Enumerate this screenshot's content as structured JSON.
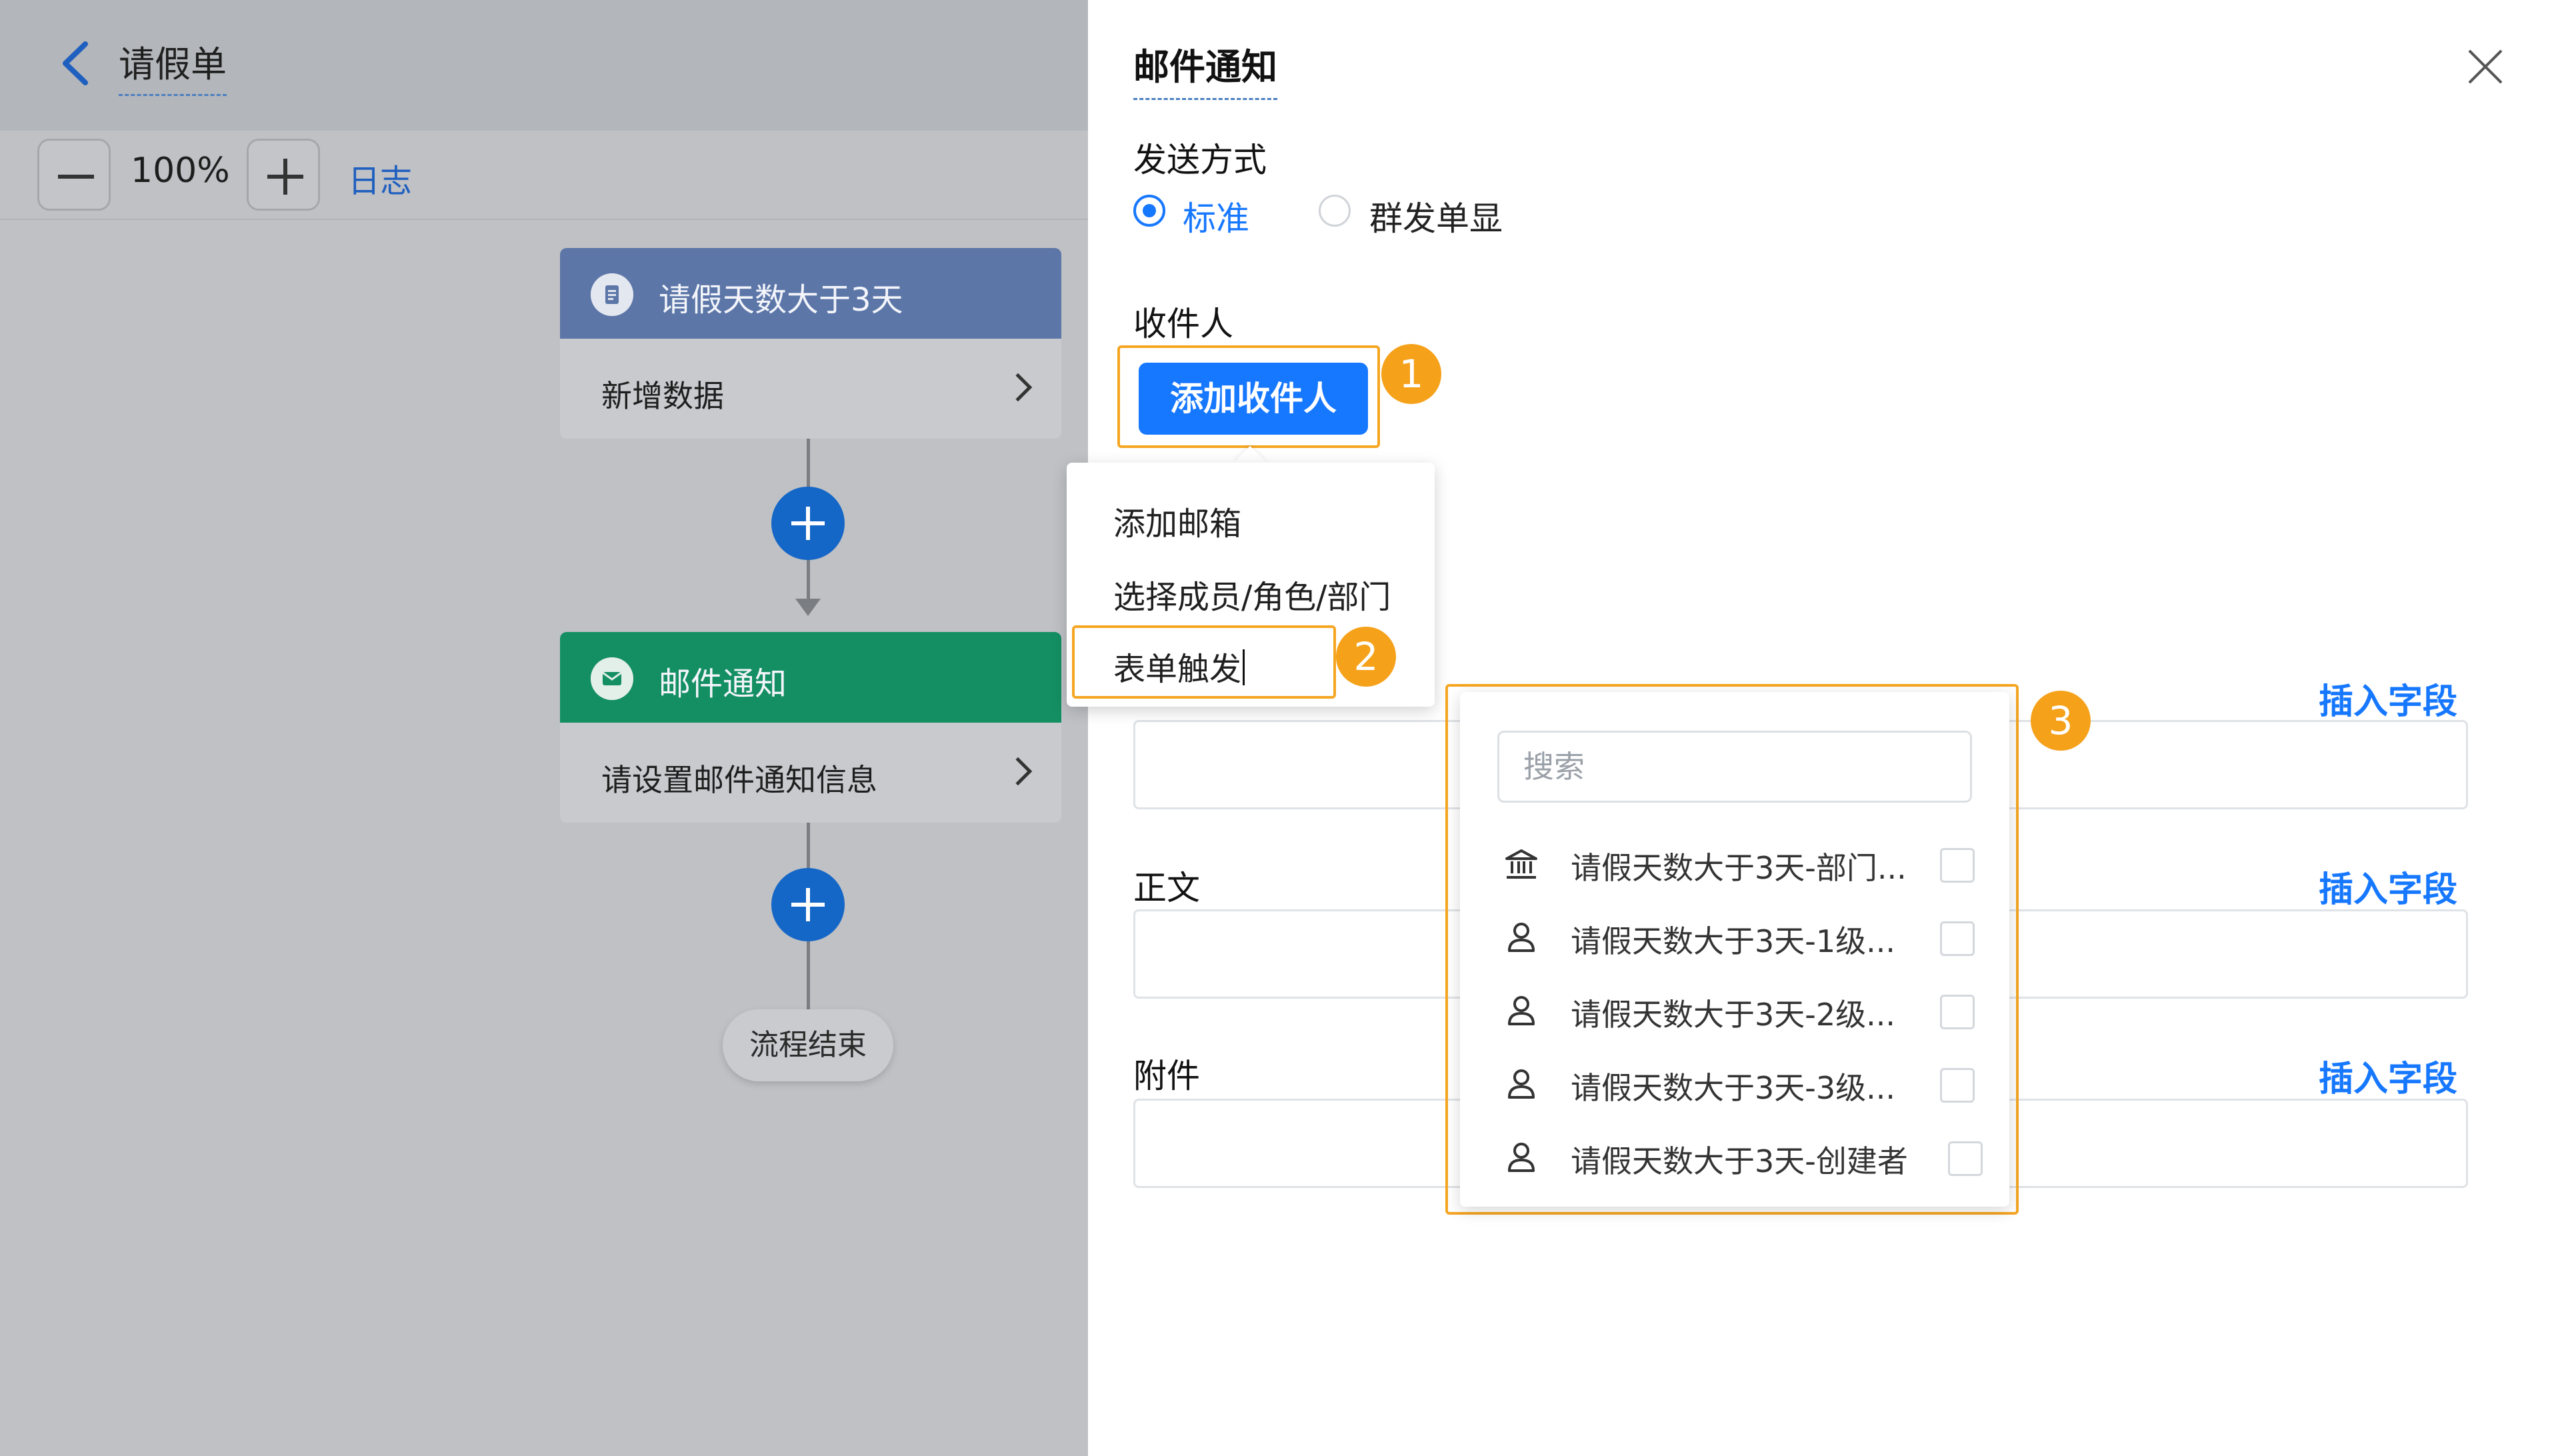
{
  "header": {
    "title": "请假单"
  },
  "toolbar": {
    "zoom": "100%",
    "log_label": "日志"
  },
  "flow": {
    "node1": {
      "title": "请假天数大于3天",
      "action": "新增数据"
    },
    "node2": {
      "title": "邮件通知",
      "action": "请设置邮件通知信息"
    },
    "end_label": "流程结束"
  },
  "panel": {
    "title": "邮件通知",
    "send_mode_label": "发送方式",
    "send_options": [
      "标准",
      "群发单显"
    ],
    "selected_option": "标准",
    "recipients_label": "收件人",
    "add_recipient_button": "添加收件人",
    "body_label": "正文",
    "attachment_label": "附件",
    "insert_field_label": "插入字段"
  },
  "recipient_menu": {
    "items": [
      "添加邮箱",
      "选择成员/角色/部门",
      "表单触发"
    ]
  },
  "field_dropdown": {
    "search_placeholder": "搜索",
    "items": [
      {
        "icon": "building-icon",
        "label": "请假天数大于3天-部门..."
      },
      {
        "icon": "user-icon",
        "label": "请假天数大于3天-1级..."
      },
      {
        "icon": "user-icon",
        "label": "请假天数大于3天-2级..."
      },
      {
        "icon": "user-icon",
        "label": "请假天数大于3天-3级..."
      },
      {
        "icon": "user-icon",
        "label": "请假天数大于3天-创建者"
      }
    ]
  },
  "callouts": [
    "1",
    "2",
    "3"
  ],
  "colors": {
    "primary": "#1677ff",
    "callout": "#f5a623",
    "node1_header": "#5c76a8",
    "node2_header": "#148f63",
    "add_circle": "#1466c7"
  }
}
